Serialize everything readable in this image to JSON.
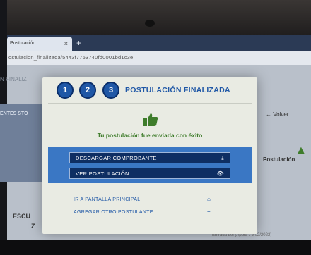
{
  "browser": {
    "tab_title": "Postulación",
    "tab_close": "×",
    "new_tab": "+",
    "url": "ostulacion_finalizada/5443f7763740fd0001bd1c3e"
  },
  "background": {
    "left_label": "N FINALIZ",
    "left_panel_text": "ENTES STO",
    "school_line1": "ESCU",
    "school_line2": "Z",
    "back_link": "Volver",
    "back_icon": "arrow-left-icon",
    "right_label": "Postulación",
    "footer": "Entrada del (Apple 7 v.02/2022)"
  },
  "modal": {
    "steps": [
      "1",
      "2",
      "3"
    ],
    "title": "POSTULACIÓN FINALIZADA",
    "success_message": "Tu postulación fue enviada con éxito",
    "buttons": [
      {
        "label": "DESCARGAR COMPROBANTE",
        "icon": "download-icon",
        "glyph": "⤓"
      },
      {
        "label": "VER POSTULACIÓN",
        "icon": "eye-icon",
        "glyph": "👁"
      }
    ],
    "links": [
      {
        "label": "IR A PANTALLA PRINCIPAL",
        "icon": "home-icon",
        "glyph": "⌂"
      },
      {
        "label": "AGREGAR OTRO POSTULANTE",
        "icon": "plus-icon",
        "glyph": "+"
      }
    ],
    "colors": {
      "accent": "#1f57a6",
      "success": "#3e7c2b",
      "band": "#3a77c4",
      "button": "#0e2e63"
    }
  }
}
